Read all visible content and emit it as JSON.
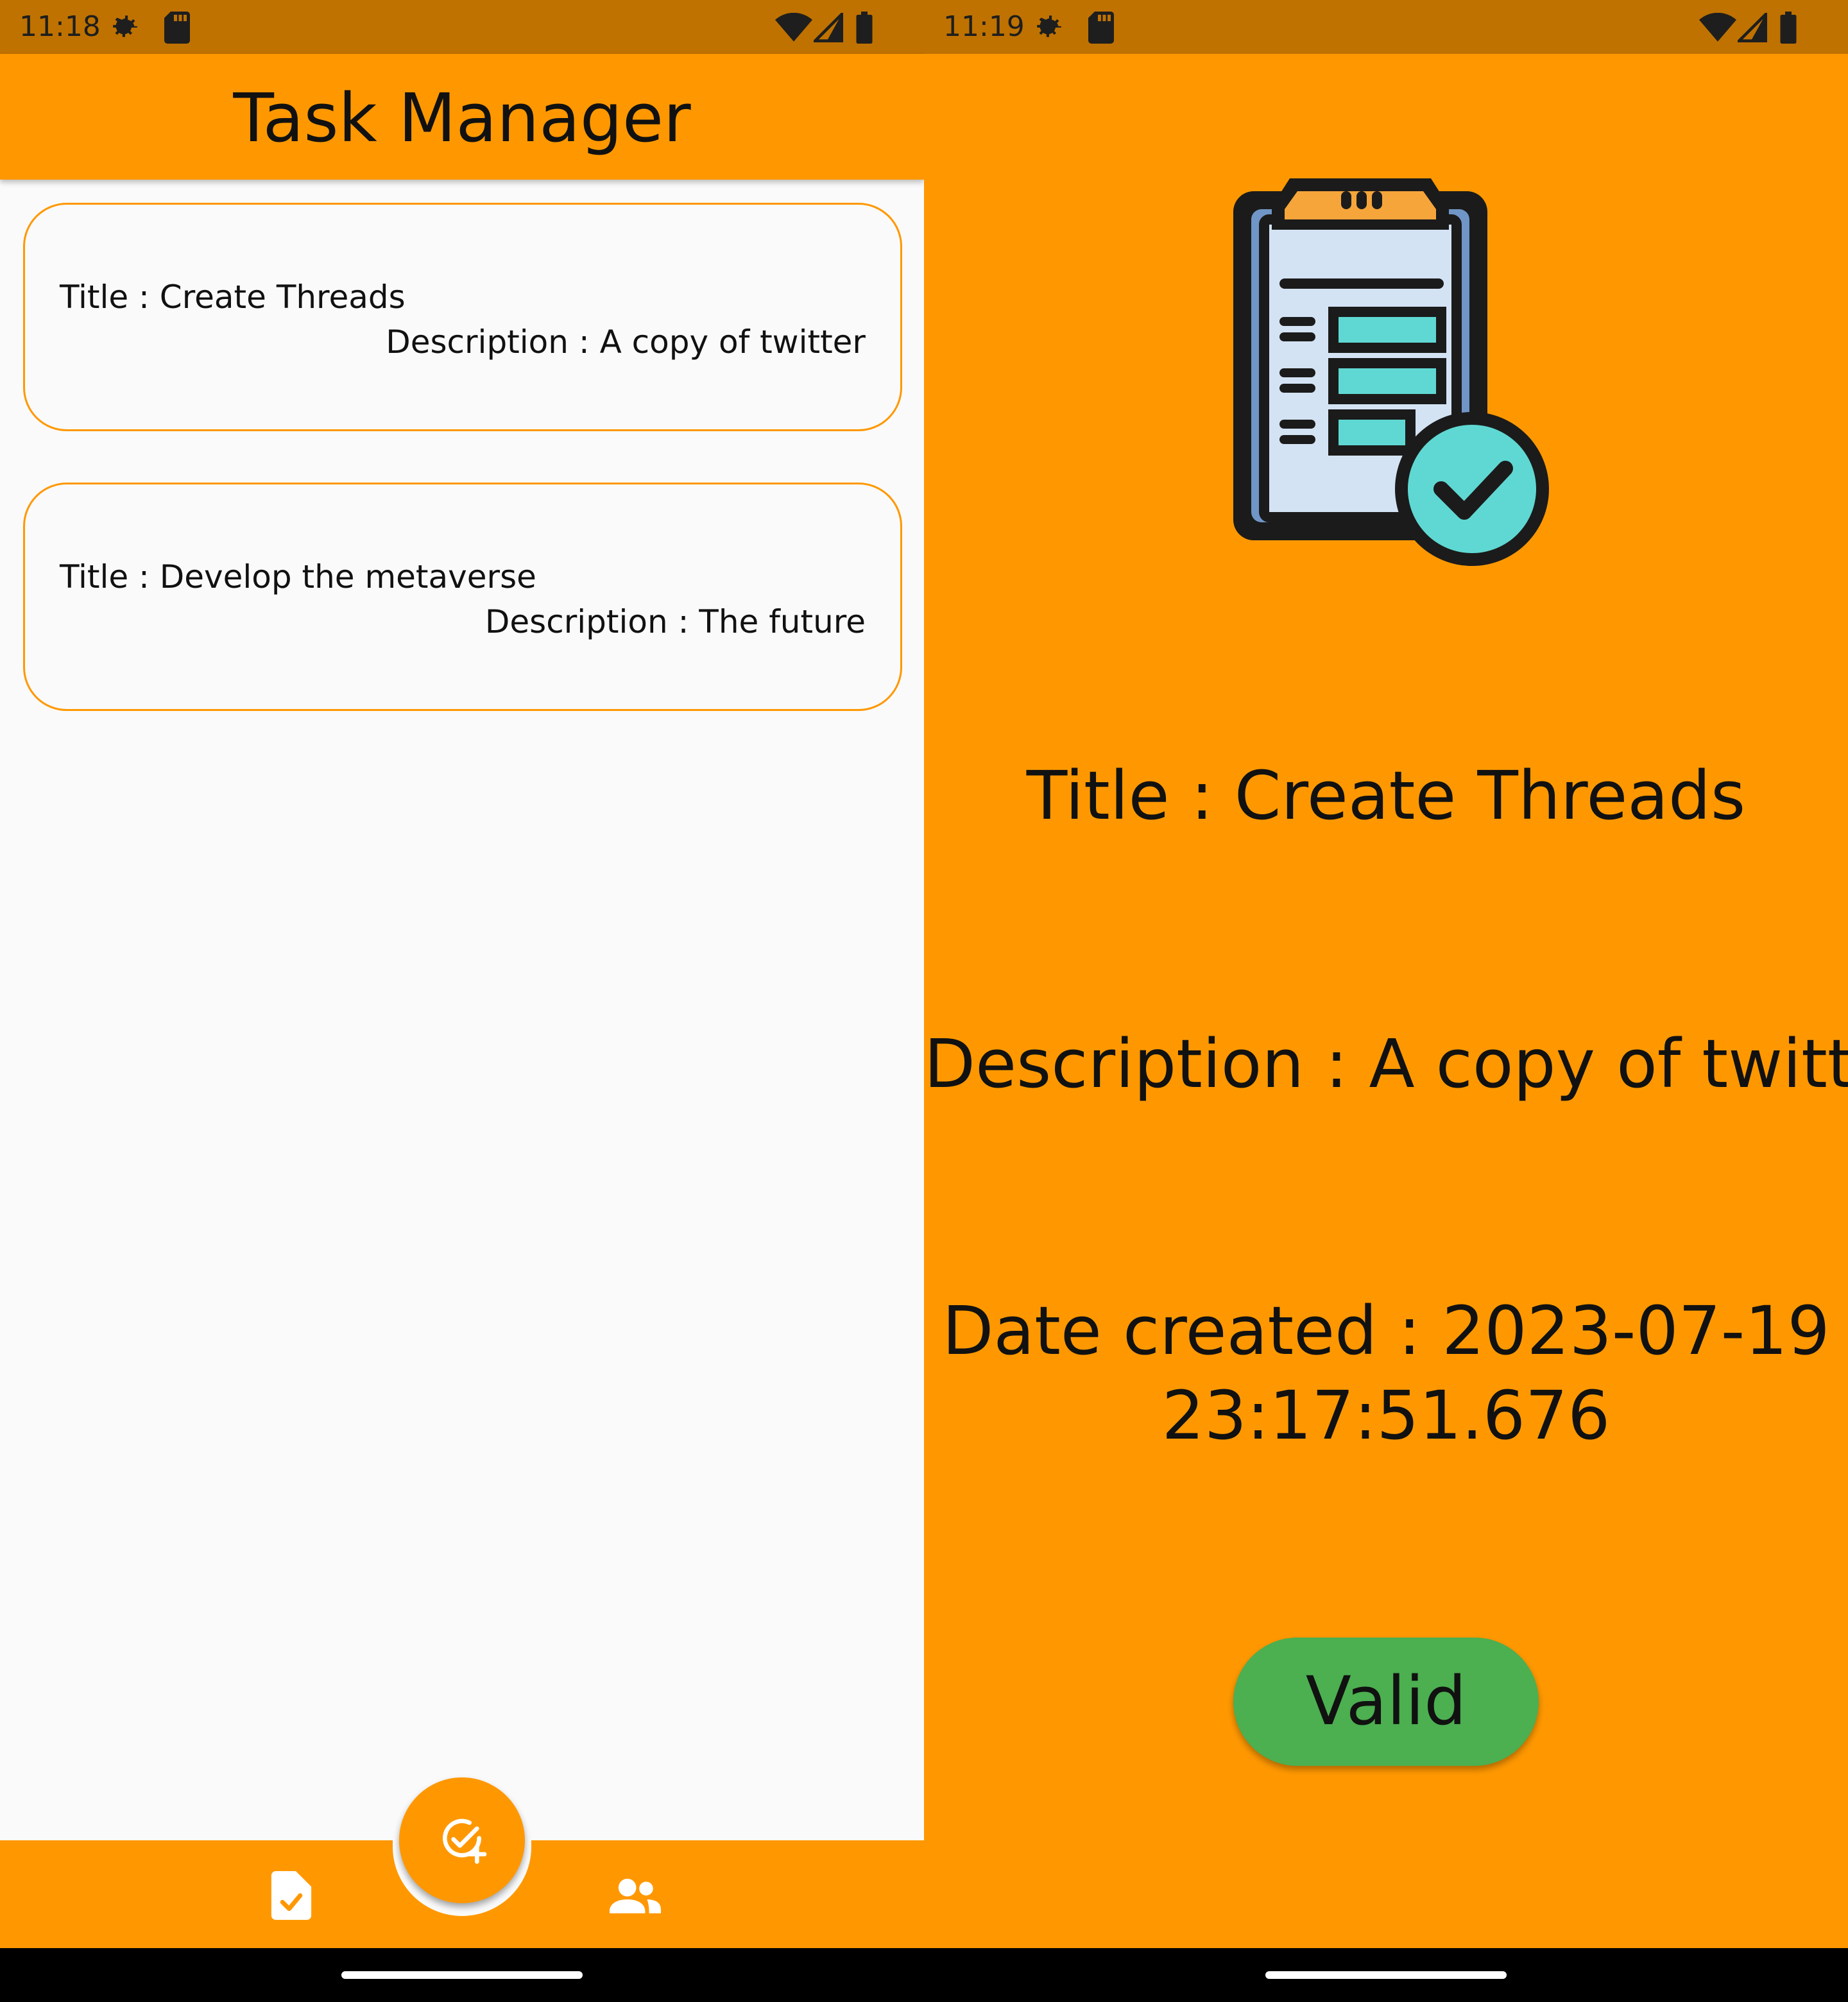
{
  "left_screen": {
    "status_bar": {
      "time": "11:18"
    },
    "app_bar": {
      "title": "Task Manager"
    },
    "tasks": [
      {
        "title": "Title : Create Threads",
        "description": "Description : A copy of twitter"
      },
      {
        "title": "Title : Develop the metaverse",
        "description": "Description : The future"
      }
    ],
    "bottom_nav": {
      "fab_icon": "add-task-icon",
      "items": [
        {
          "icon": "task-document-icon"
        },
        {
          "icon": "people-icon"
        }
      ]
    }
  },
  "right_screen": {
    "status_bar": {
      "time": "11:19"
    },
    "illustration_icon": "clipboard-checklist-icon",
    "title": "Title : Create Threads",
    "description": "Description : A copy of twitter",
    "date_created": "Date created : 2023-07-19 23:17:51.676",
    "valid_button_label": "Valid"
  },
  "colors": {
    "accent": "#ff9800",
    "status_bar": "#bf7200",
    "valid_button": "#4caf50",
    "background": "#fafafa"
  }
}
